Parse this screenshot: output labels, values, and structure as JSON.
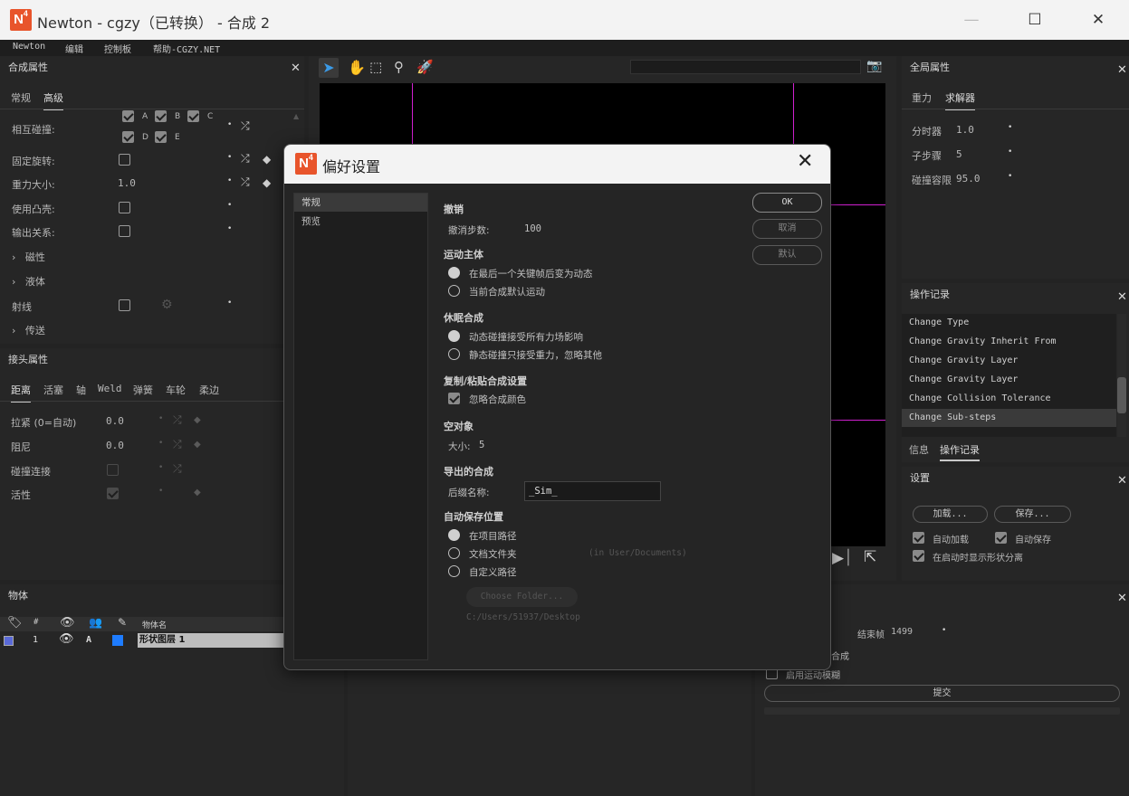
{
  "window": {
    "title": "Newton - cgzy（已转换） - 合成 2",
    "logo": "N",
    "logo_sup": "4",
    "minimize": "—",
    "maximize": "☐",
    "close": "✕"
  },
  "menu": [
    "Newton",
    "编辑",
    "控制板",
    "帮助-CGZY.NET"
  ],
  "comp_panel": {
    "title": "合成属性",
    "tabs": [
      "常规",
      "高级"
    ],
    "active_tab": "高级",
    "rows": {
      "mutual_collision": "相互碰撞:",
      "fixed_rotation": "固定旋转:",
      "gravity": "重力大小:",
      "gravity_value": "1.0",
      "convex": "使用凸壳:",
      "output_relation": "输出关系:",
      "magnetism": "磁性",
      "liquid": "液体",
      "ray": "射线",
      "transfer": "传送"
    },
    "collision_groups": [
      "A",
      "B",
      "C",
      "D",
      "E"
    ]
  },
  "joint_panel": {
    "title": "接头属性",
    "tabs": [
      "距离",
      "活塞",
      "轴",
      "Weld",
      "弹簧",
      "车轮",
      "柔边"
    ],
    "rows": [
      {
        "label": "拉紧 (0=自动)",
        "value": "0.0"
      },
      {
        "label": "阻尼",
        "value": "0.0"
      },
      {
        "label": "碰撞连接",
        "value": ""
      },
      {
        "label": "活性",
        "value": ""
      }
    ]
  },
  "bodies_panel": {
    "title": "物体",
    "header": [
      "#",
      "物体名"
    ],
    "row": {
      "index": "1",
      "mode": "A",
      "name": "形状图层 1"
    }
  },
  "global_panel": {
    "title": "全局属性",
    "tabs": [
      "重力",
      "求解器"
    ],
    "rows": [
      {
        "label": "分时器",
        "value": "1.0"
      },
      {
        "label": "子步骤",
        "value": "5"
      },
      {
        "label": "碰撞容限",
        "value": "95.0"
      }
    ]
  },
  "history_panel": {
    "title": "操作记录",
    "items": [
      "Change Type",
      "Change Gravity Inherit From",
      "Change Gravity Layer",
      "Change Gravity Layer",
      "Change Collision Tolerance",
      "Change Sub-steps"
    ],
    "selected": "Change Sub-steps",
    "tabs": [
      "信息",
      "操作记录"
    ]
  },
  "settings_panel": {
    "title": "设置",
    "load": "加载...",
    "save": "保存...",
    "auto_load": "自动加载",
    "auto_save": "自动保存",
    "show_shapes": "在启动时显示形状分离"
  },
  "export_panel": {
    "end_frame_label": "结束帧",
    "end_frame": "1499",
    "partial_label": "合成",
    "motion_blur": "启用运动模糊",
    "submit": "提交"
  },
  "dialog": {
    "title": "偏好设置",
    "nav": [
      "常规",
      "预览"
    ],
    "ok": "OK",
    "cancel": "取消",
    "default": "默认",
    "undo": {
      "title": "撤销",
      "steps_label": "撤消步数:",
      "steps": "100"
    },
    "motion": {
      "title": "运动主体",
      "opt1": "在最后一个关键帧后变为动态",
      "opt2": "当前合成默认运动"
    },
    "sleep": {
      "title": "休眠合成",
      "opt1": "动态碰撞接受所有力场影响",
      "opt2": "静态碰撞只接受重力，忽略其他"
    },
    "copy": {
      "title": "复制/粘贴合成设置",
      "ignore_color": "忽略合成颜色"
    },
    "null": {
      "title": "空对象",
      "size_label": "大小:",
      "size": "5"
    },
    "export": {
      "title": "导出的合成",
      "suffix_label": "后缀名称:",
      "suffix": "_Sim_"
    },
    "autosave": {
      "title": "自动保存位置",
      "opt1": "在项目路径",
      "opt2": "文档文件夹",
      "opt2_hint": "(in User/Documents)",
      "opt3": "自定义路径",
      "choose": "Choose Folder...",
      "path": "C:/Users/51937/Desktop"
    }
  },
  "colors": {
    "accent_blue": "#3b9be8",
    "accent_orange": "#e8a73b",
    "guide_magenta": "#d020d0",
    "logo": "#e8542b"
  }
}
